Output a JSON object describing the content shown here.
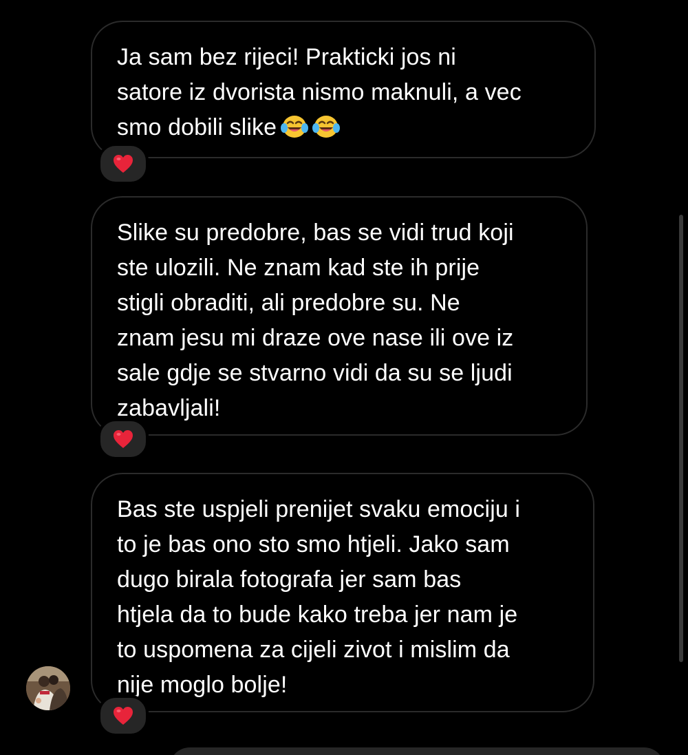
{
  "messages": [
    {
      "text": "Ja sam bez rijeci! Prakticki jos ni\nsatore iz dvorista nismo maknuli, a vec\nsmo dobili slike",
      "emoji_suffix": [
        "face-with-tears-of-joy",
        "face-with-tears-of-joy"
      ],
      "reaction": "red-heart"
    },
    {
      "text": "Slike su predobre, bas se vidi trud koji\nste ulozili. Ne znam kad ste ih prije\nstigli obraditi, ali predobre su. Ne\nznam jesu mi draze ove nase ili ove iz\nsale gdje se stvarno vidi da su se ljudi\nzabavljali!",
      "reaction": "red-heart"
    },
    {
      "text": "Bas ste uspjeli prenijet svaku emociju i\nto je bas ono sto smo htjeli. Jako sam\ndugo birala fotografa jer sam bas\nhtjela da to bude kako treba jer nam je\nto uspomena za cijeli zivot i mislim da\nnije moglo bolje!",
      "reaction": "red-heart"
    }
  ],
  "sender_avatar": "sender-avatar-photo",
  "colors": {
    "background": "#000000",
    "bubble_border": "#2b2b2b",
    "text": "#ffffff",
    "reaction_bg": "#262626",
    "heart": "#e8243a",
    "scrollbar": "#3a3a3a"
  }
}
